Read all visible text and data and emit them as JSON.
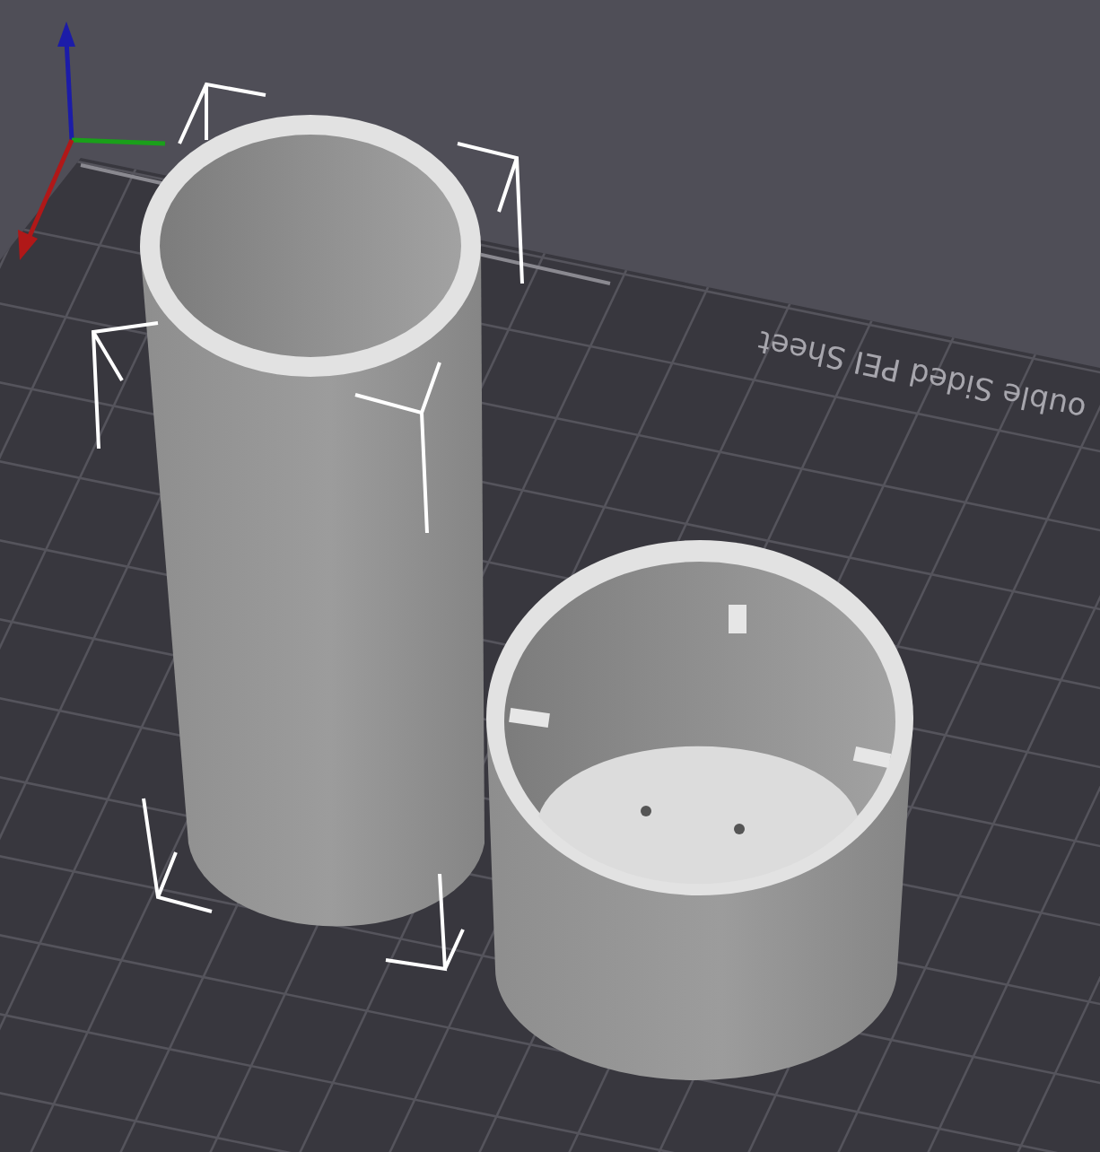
{
  "bed": {
    "label": "ouble Sided PEI Sheet"
  },
  "objects": [
    {
      "kind": "tube",
      "selected": true
    },
    {
      "kind": "cup",
      "selected": false
    }
  ]
}
